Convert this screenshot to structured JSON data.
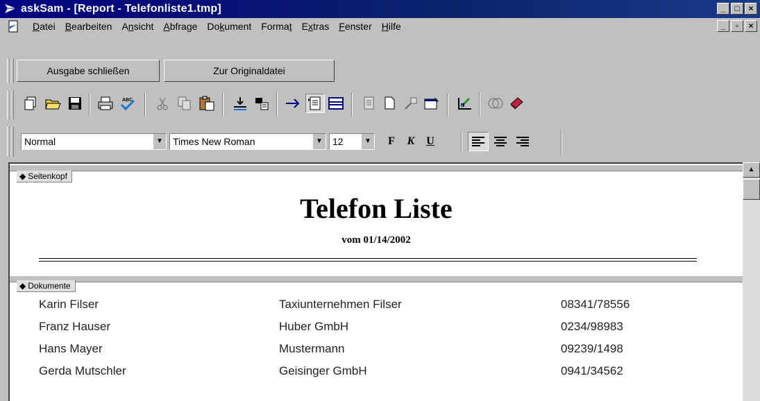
{
  "window": {
    "title": "askSam - [Report - Telefonliste1.tmp]",
    "controls": [
      "_",
      "□",
      "×"
    ],
    "mdi_controls": [
      "_",
      "▫",
      "×"
    ]
  },
  "menu": {
    "items": [
      {
        "label_pre": "",
        "label_u": "D",
        "label_post": "atei"
      },
      {
        "label_pre": "",
        "label_u": "B",
        "label_post": "earbeiten"
      },
      {
        "label_pre": "A",
        "label_u": "n",
        "label_post": "sicht"
      },
      {
        "label_pre": "",
        "label_u": "A",
        "label_post": "bfrage"
      },
      {
        "label_pre": "Do",
        "label_u": "k",
        "label_post": "ument"
      },
      {
        "label_pre": "Forma",
        "label_u": "t",
        "label_post": ""
      },
      {
        "label_pre": "E",
        "label_u": "x",
        "label_post": "tras"
      },
      {
        "label_pre": "",
        "label_u": "F",
        "label_post": "enster"
      },
      {
        "label_pre": "",
        "label_u": "H",
        "label_post": "ilfe"
      }
    ]
  },
  "toolbar": {
    "close_output": "Ausgabe schließen",
    "to_original": "Zur Originaldatei"
  },
  "format": {
    "style": "Normal",
    "font": "Times New Roman",
    "size": "12",
    "bold": "F",
    "italic": "K",
    "underline": "U"
  },
  "report": {
    "header_section": "Seitenkopf",
    "title": "Telefon Liste",
    "subtitle": "vom 01/14/2002",
    "docs_section": "Dokumente",
    "rows": [
      {
        "name": "Karin Filser",
        "company": "Taxiunternehmen Filser",
        "phone": "08341/78556"
      },
      {
        "name": "Franz Hauser",
        "company": "Huber GmbH",
        "phone": "0234/98983"
      },
      {
        "name": "Hans Mayer",
        "company": "Mustermann",
        "phone": "09239/1498"
      },
      {
        "name": "Gerda Mutschler",
        "company": "Geisinger GmbH",
        "phone": "0941/34562"
      }
    ]
  },
  "colors": {
    "titlebar": "#000080",
    "chrome": "#c0c0c0"
  }
}
